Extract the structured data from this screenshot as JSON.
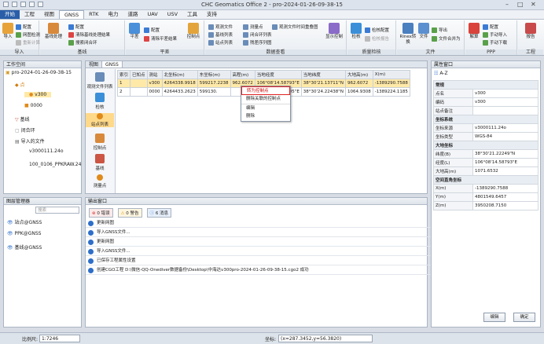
{
  "title": "CHC Geomatics Office 2 - pro-2024-01-26-09-38-15",
  "menu": [
    "开始",
    "工程",
    "视图",
    "GNSS",
    "RTK",
    "电力",
    "道路",
    "UAV",
    "USV",
    "工具",
    "支持"
  ],
  "ribbon": {
    "import": {
      "big": "导入",
      "items": [
        "配置",
        "网图检测",
        "重新计算"
      ],
      "label": "导入"
    },
    "baseline": {
      "big": "基线处理",
      "items": [
        "配置",
        "清除基线处理结果",
        "搜索闭合环"
      ],
      "label": "基线"
    },
    "adjust": {
      "big": "平差",
      "items": [
        "配置",
        "清除平差结果"
      ],
      "control": "控制点",
      "label": "平差"
    },
    "data": {
      "items": [
        "观测文件",
        "基线列表",
        "站点列表",
        "测量点",
        "闭合环列表",
        "残差序列图",
        "观测文件时间重叠图"
      ],
      "show": "显示控制",
      "label": "数据查看"
    },
    "quality": {
      "check": "检核",
      "items": [
        "检核配置",
        "检核报告"
      ],
      "label": "质量检核"
    },
    "file": {
      "rinex": "Rinex转换",
      "big": "文件",
      "items": [
        "导出",
        "文件合并为"
      ],
      "label": "文件"
    },
    "ppp": {
      "big": "解算",
      "items": [
        "配置",
        "手动导入",
        "手动下载"
      ],
      "label": "PPP"
    },
    "tools": {
      "big": "报告",
      "label": "工程"
    }
  },
  "workspace": {
    "title": "工作空间",
    "root": "pro-2024-01-26-09-38-15",
    "nodes": [
      "点",
      "v300",
      "0000",
      "基线",
      "闭合环",
      "导入的文件",
      "v3000111.24o",
      "100_0106_PPKRAW.24"
    ]
  },
  "layers": {
    "title": "图层管理器",
    "search_placeholder": "搜索",
    "items": [
      "站点@GNSS",
      "PPK@GNSS",
      "基线@GNSS"
    ]
  },
  "doc_tabs": [
    "视图",
    "GNSS"
  ],
  "side_icons": [
    "观测文件列表",
    "检核",
    "站点列表",
    "控制点",
    "基线",
    "测量点"
  ],
  "table": {
    "headers": [
      "索引",
      "已知点",
      "测站",
      "北坐标(m)",
      "东坐标(m)",
      "高程(m)",
      "当地经度",
      "当地纬度",
      "大地高(m)",
      "X(m)"
    ],
    "rows": [
      [
        "1",
        "",
        "v300",
        "4264338.9918",
        "599217.2238",
        "962.6072",
        "106°08'14.58793\"E",
        "38°30'21.13711\"N",
        "962.6072",
        "-1389290.7588"
      ],
      [
        "2",
        "",
        "0000",
        "4264433.2623",
        "599130.",
        "",
        "106°08'11.47695\"E",
        "38°30'24.22438\"N",
        "1064.9308",
        "-1389224.1185"
      ]
    ]
  },
  "context_menu": [
    "转为控制点",
    "删除关联的控制点",
    "编辑",
    "删除"
  ],
  "output": {
    "title": "输出窗口",
    "filters": [
      "0 错误",
      "0 警告",
      "6 消息"
    ],
    "messages": [
      "更新网图",
      "导入GNSS文件...",
      "更新网图",
      "导入GNSS文件...",
      "已保存工程属性设置",
      "创建CGO工程 D:\\微信-QQ-Onediver数据备份\\Desktop\\中海达v300pro-2024-01-26-09-38-15.cgo2 成功"
    ]
  },
  "properties": {
    "title": "属性窗口",
    "sections": [
      {
        "name": "常规",
        "rows": [
          [
            "点名",
            "v300"
          ],
          [
            "编码",
            "v300"
          ],
          [
            "站点备注",
            ""
          ]
        ]
      },
      {
        "name": "坐标系统",
        "rows": [
          [
            "坐标来源",
            "v3000111.24o"
          ],
          [
            "坐标类型",
            "WGS-84"
          ]
        ]
      },
      {
        "name": "大地坐标",
        "rows": [
          [
            "纬度(B)",
            "38°30'21.22249\"N"
          ],
          [
            "经度(L)",
            "106°08'14.58793\"E"
          ],
          [
            "大地高(m)",
            "1071.6532"
          ]
        ]
      },
      {
        "name": "空间直角坐标",
        "rows": [
          [
            "X(m)",
            "-1389290.7588"
          ],
          [
            "Y(m)",
            "4801549.6457"
          ],
          [
            "Z(m)",
            "3950208.7150"
          ]
        ]
      }
    ],
    "edit": "编辑",
    "ok": "确定"
  },
  "status": {
    "scale_label": "比例尺:",
    "scale": "1:7246",
    "coord_label": "坐标:",
    "coord": "(x=287.3452,y=56.3820)"
  },
  "colors": {
    "accent": "#2a5ea8",
    "highlight": "#ffe9a8",
    "ctxbox": "#e02020"
  }
}
